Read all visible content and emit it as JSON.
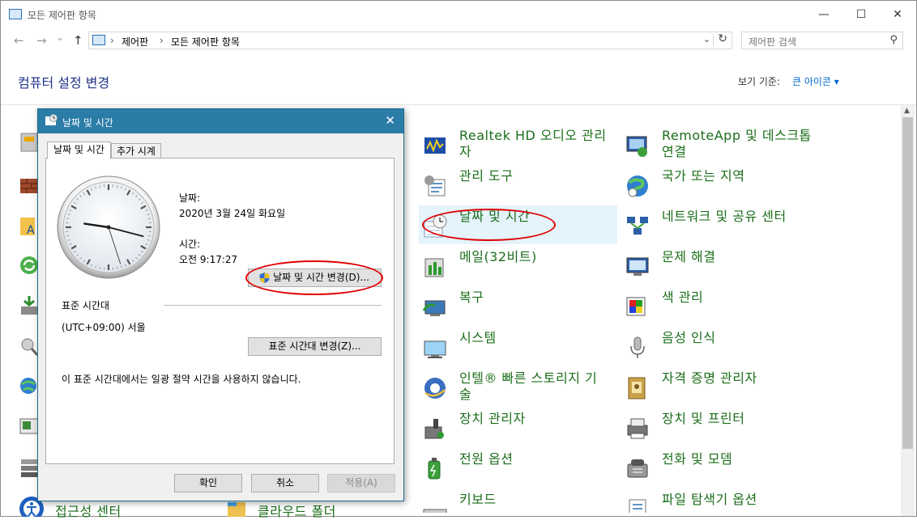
{
  "window": {
    "title": "모든 제어판 항목",
    "minimize_glyph": "—",
    "maximize_glyph": "☐",
    "close_glyph": "✕"
  },
  "nav": {
    "back_glyph": "←",
    "forward_glyph": "→",
    "recent_glyph": "⌄",
    "up_glyph": "↑",
    "breadcrumb": [
      "제어판",
      "모든 제어판 항목"
    ],
    "crumb_sep": "›",
    "dropdown_glyph": "⌄",
    "refresh_glyph": "↻",
    "search_placeholder": "제어판 검색",
    "search_glyph": "⚲"
  },
  "header": {
    "title": "컴퓨터 설정 변경",
    "view_by_label": "보기 기준:",
    "view_by_value": "큰 아이콘 ▾"
  },
  "items_col3": [
    {
      "label_line1": "Realtek HD 오디오 관리",
      "label_line2": "자",
      "icon": "audio-manager-icon"
    },
    {
      "label_line1": "관리 도구",
      "label_line2": "",
      "icon": "admin-tools-icon"
    },
    {
      "label_line1": "날짜 및 시간",
      "label_line2": "",
      "icon": "date-time-icon"
    },
    {
      "label_line1": "메일(32비트)",
      "label_line2": "",
      "icon": "mail-icon"
    },
    {
      "label_line1": "복구",
      "label_line2": "",
      "icon": "recovery-icon"
    },
    {
      "label_line1": "시스템",
      "label_line2": "",
      "icon": "system-icon"
    },
    {
      "label_line1": "인텔® 빠른 스토리지 기",
      "label_line2": "술",
      "icon": "intel-storage-icon"
    },
    {
      "label_line1": "장치 관리자",
      "label_line2": "",
      "icon": "device-manager-icon"
    },
    {
      "label_line1": "전원 옵션",
      "label_line2": "",
      "icon": "power-options-icon"
    },
    {
      "label_line1": "키보드",
      "label_line2": "",
      "icon": "keyboard-icon"
    }
  ],
  "items_col4": [
    {
      "label_line1": "RemoteApp 및 데스크톱",
      "label_line2": "연결",
      "icon": "remoteapp-icon"
    },
    {
      "label_line1": "국가 또는 지역",
      "label_line2": "",
      "icon": "region-icon"
    },
    {
      "label_line1": "네트워크 및 공유 센터",
      "label_line2": "",
      "icon": "network-icon"
    },
    {
      "label_line1": "문제 해결",
      "label_line2": "",
      "icon": "troubleshoot-icon"
    },
    {
      "label_line1": "색 관리",
      "label_line2": "",
      "icon": "color-management-icon"
    },
    {
      "label_line1": "음성 인식",
      "label_line2": "",
      "icon": "speech-recognition-icon"
    },
    {
      "label_line1": "자격 증명 관리자",
      "label_line2": "",
      "icon": "credential-manager-icon"
    },
    {
      "label_line1": "장치 및 프린터",
      "label_line2": "",
      "icon": "devices-printers-icon"
    },
    {
      "label_line1": "전화 및 모뎀",
      "label_line2": "",
      "icon": "phone-modem-icon"
    },
    {
      "label_line1": "파일 탐색기 옵션",
      "label_line2": "",
      "icon": "explorer-options-icon"
    }
  ],
  "bottom_row_partial": [
    {
      "label": "접근성 센터",
      "icon": "ease-of-access-icon"
    },
    {
      "label": "클라우드 폴더",
      "icon": "cloud-folder-icon"
    }
  ],
  "dialog": {
    "title": "날짜 및 시간",
    "close_glyph": "✕",
    "tabs": [
      "날짜 및 시간",
      "추가 시계"
    ],
    "date_label": "날짜:",
    "date_value": "2020년 3월 24일 화요일",
    "time_label": "시간:",
    "time_value": "오전 9:17:27",
    "clock": {
      "hour": 9,
      "minute": 17,
      "second": 27
    },
    "change_datetime_button": "날짜 및 시간 변경(D)...",
    "timezone_header": "표준 시간대",
    "timezone_value": "(UTC+09:00) 서울",
    "change_timezone_button": "표준 시간대 변경(Z)...",
    "dst_note": "이 표준 시간대에서는 일광 절약 시간을 사용하지 않습니다.",
    "ok_button": "확인",
    "cancel_button": "취소",
    "apply_button": "적용(A)"
  },
  "colors": {
    "item_text": "#1b6e1b",
    "header_title": "#1e3287",
    "dialog_title_bar": "#2b7da8",
    "annotation_red": "#e00000",
    "selected_item_bg": "#e5f3fb"
  }
}
